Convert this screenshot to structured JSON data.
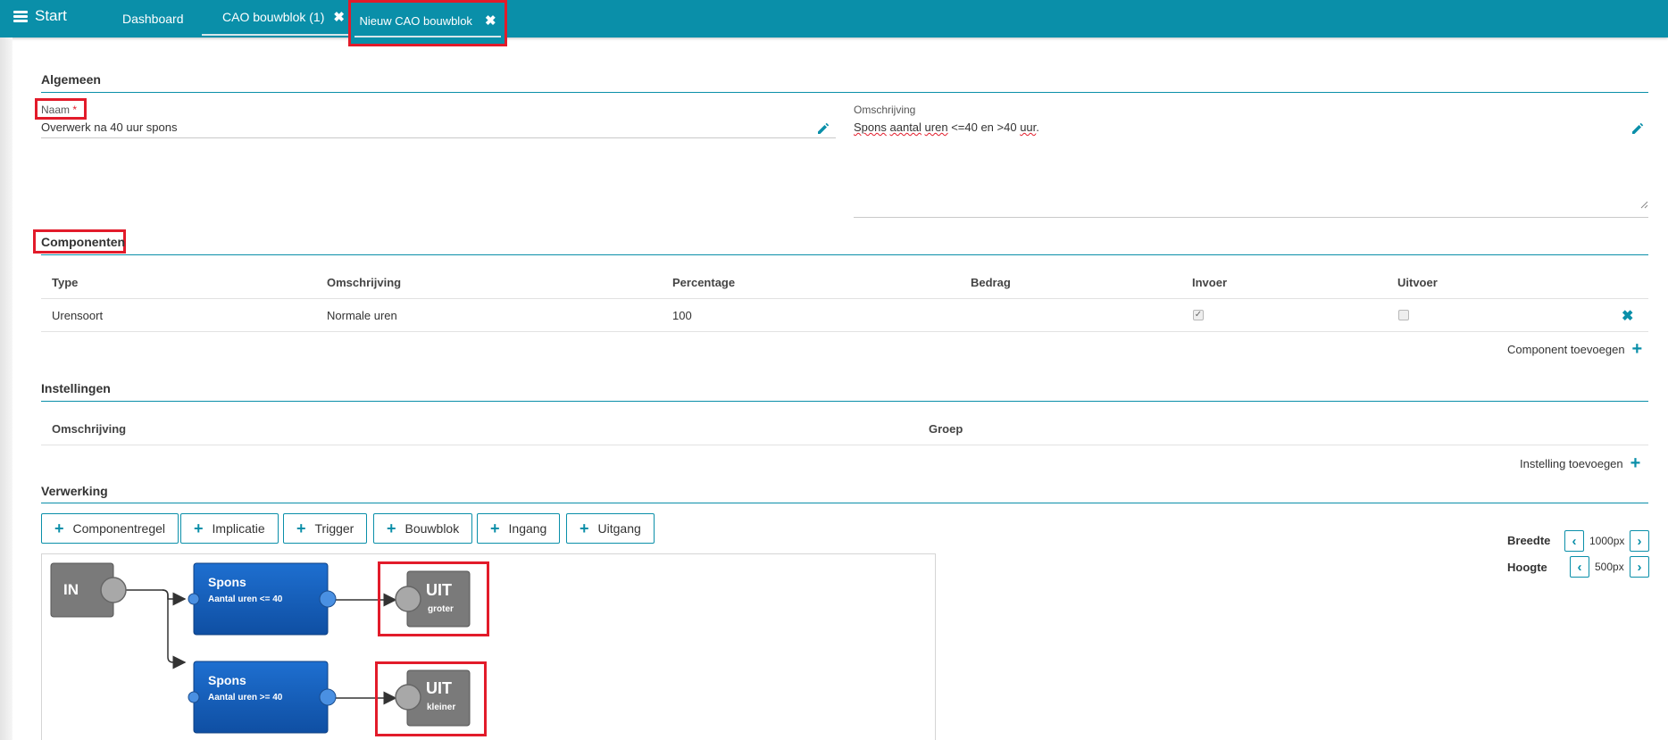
{
  "nav": {
    "start": "Start",
    "tabs": [
      {
        "label": "Dashboard"
      },
      {
        "label": "CAO bouwblok (1)"
      },
      {
        "label": "Nieuw CAO bouwblok"
      }
    ]
  },
  "algemeen": {
    "title": "Algemeen",
    "naam_label": "Naam",
    "required_mark": "*",
    "naam_value": "Overwerk na 40 uur spons",
    "omschrijving_label": "Omschrijving",
    "omschrijving_value_parts": [
      "Spons",
      " ",
      "aantal",
      " ",
      "uren",
      " <=40 en >40 ",
      "uur",
      "."
    ]
  },
  "componenten": {
    "title": "Componenten",
    "headers": [
      "Type",
      "Omschrijving",
      "Percentage",
      "Bedrag",
      "Invoer",
      "Uitvoer"
    ],
    "rows": [
      {
        "type": "Urensoort",
        "omschrijving": "Normale uren",
        "percentage": "100",
        "bedrag": "",
        "invoer": true,
        "uitvoer": false
      }
    ],
    "add_label": "Component toevoegen"
  },
  "instellingen": {
    "title": "Instellingen",
    "headers": [
      "Omschrijving",
      "Groep"
    ],
    "add_label": "Instelling toevoegen"
  },
  "verwerking": {
    "title": "Verwerking",
    "buttons": [
      "Componentregel",
      "Implicatie",
      "Trigger",
      "Bouwblok",
      "Ingang",
      "Uitgang"
    ],
    "breedte_label": "Breedte",
    "breedte_value": "1000px",
    "hoogte_label": "Hoogte",
    "hoogte_value": "500px",
    "nodes": {
      "in": "IN",
      "spons1_title": "Spons",
      "spons1_sub": "Aantal uren <= 40",
      "spons2_title": "Spons",
      "spons2_sub": "Aantal uren >= 40",
      "uit1_title": "UIT",
      "uit1_sub": "groter",
      "uit2_title": "UIT",
      "uit2_sub": "kleiner"
    }
  },
  "colors": {
    "accent": "#0a8fa9",
    "highlight": "#e21b2a",
    "node_blue": "#1565c0",
    "node_gray": "#7a7a7a"
  }
}
